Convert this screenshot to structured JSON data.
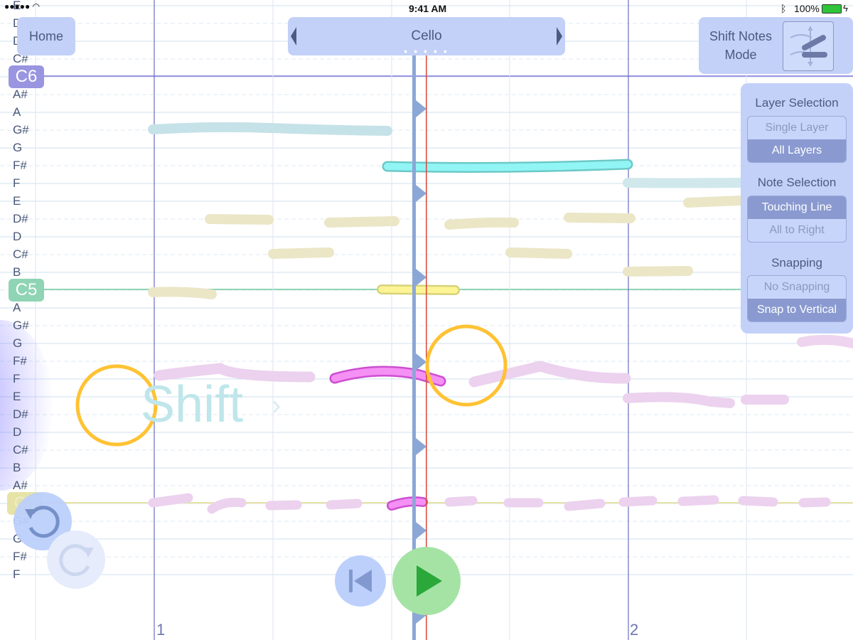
{
  "status_bar": {
    "time": "9:41 AM",
    "battery": "100%"
  },
  "toolbar": {
    "home_label": "Home",
    "instrument_label": "Cello",
    "instrument_page_dots": "● ● ● ● ●",
    "mode_label": "Shift Notes Mode",
    "mode_icon": "shift-notes-icon"
  },
  "staff": {
    "note_labels": [
      "E",
      "D#",
      "D",
      "C#",
      "B",
      "A#",
      "A",
      "G#",
      "G",
      "F#",
      "F",
      "E",
      "D#",
      "D",
      "C#",
      "B",
      "A#",
      "A",
      "G#",
      "G",
      "F#",
      "F",
      "E",
      "D#",
      "D",
      "C#",
      "B",
      "A#",
      "A",
      "G#",
      "G",
      "F#",
      "F"
    ],
    "octave_markers": [
      {
        "label": "C6",
        "color": "#9a95e0"
      },
      {
        "label": "C5",
        "color": "#8fd4b4"
      },
      {
        "label": "C4",
        "color": "#e6e3a6"
      }
    ],
    "bar_numbers": [
      "1",
      "2"
    ]
  },
  "gesture_hint": {
    "text": "Shift",
    "chevron": "›"
  },
  "panel": {
    "layer_selection": {
      "title": "Layer Selection",
      "options": [
        "Single Layer",
        "All Layers"
      ],
      "selected": "All Layers"
    },
    "note_selection": {
      "title": "Note Selection",
      "options": [
        "Touching Line",
        "All to Right"
      ],
      "selected": "Touching Line"
    },
    "snapping": {
      "title": "Snapping",
      "options": [
        "No Snapping",
        "Snap to Vertical"
      ],
      "selected": "Snap to Vertical"
    }
  },
  "controls": {
    "undo_icon": "undo-icon",
    "redo_icon": "redo-icon",
    "rewind_icon": "skip-back-icon",
    "play_icon": "play-icon"
  },
  "colors": {
    "accent": "#c3d1f8",
    "playhead": "#d9463a",
    "cursor_bar": "#8ba7d6",
    "touch_ring": "#ffc233",
    "play_green": "#2aa83a"
  }
}
